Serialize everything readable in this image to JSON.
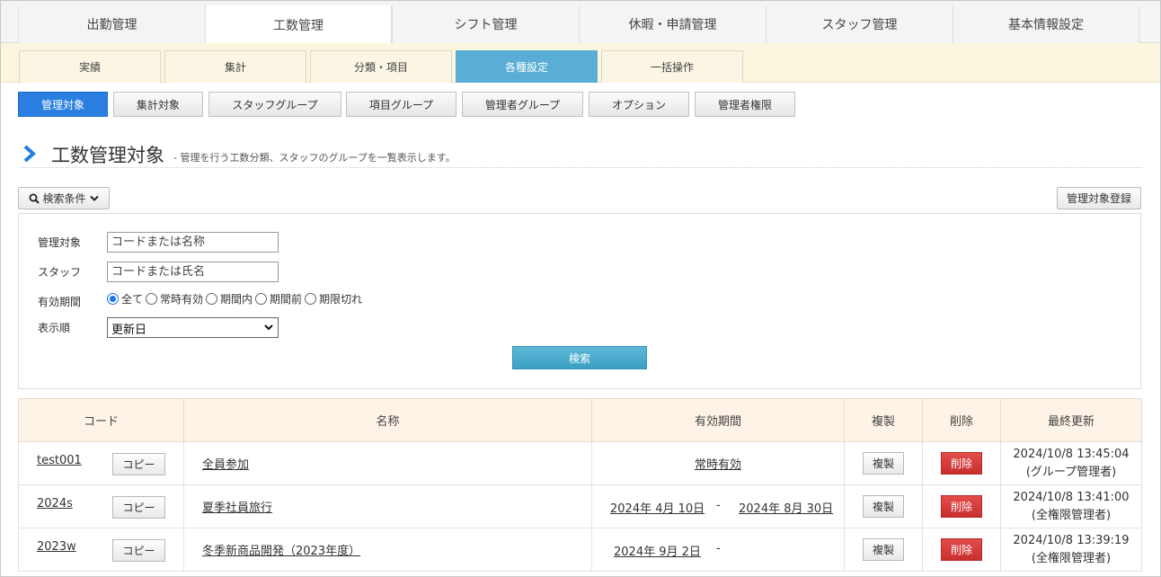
{
  "top_tabs": [
    "出勤管理",
    "工数管理",
    "シフト管理",
    "休暇・申請管理",
    "スタッフ管理",
    "基本情報設定"
  ],
  "top_active": "工数管理",
  "sub_tabs": [
    "実績",
    "集計",
    "分類・項目",
    "各種設定",
    "一括操作"
  ],
  "sub_active": "各種設定",
  "setting_buttons": [
    "管理対象",
    "集計対象",
    "スタッフグループ",
    "項目グループ",
    "管理者グループ",
    "オプション",
    "管理者権限"
  ],
  "setting_active": "管理対象",
  "page": {
    "title": "工数管理対象",
    "description": "- 管理を行う工数分類、スタッフのグループを一覧表示します。"
  },
  "search_toggle_label": "検索条件",
  "register_button": "管理対象登録",
  "search": {
    "target_label": "管理対象",
    "target_placeholder": "コードまたは名称",
    "staff_label": "スタッフ",
    "staff_placeholder": "コードまたは氏名",
    "period_label": "有効期間",
    "period_options": [
      "全て",
      "常時有効",
      "期間内",
      "期間前",
      "期限切れ"
    ],
    "period_selected": "全て",
    "order_label": "表示順",
    "order_value": "更新日",
    "submit_label": "検索"
  },
  "table": {
    "headers": [
      "コード",
      "名称",
      "有効期間",
      "複製",
      "削除",
      "最終更新"
    ],
    "copy_label": "コピー",
    "duplicate_label": "複製",
    "delete_label": "削除",
    "rows": [
      {
        "code": "test001",
        "name": "全員参加",
        "period_always": "常時有効",
        "period_start": "",
        "period_sep": "",
        "period_end": "",
        "updated": "2024/10/8 13:45:04",
        "updated_by": "(グループ管理者)"
      },
      {
        "code": "2024s",
        "name": "夏季社員旅行",
        "period_always": "",
        "period_start": "2024年 4月 10日",
        "period_sep": "-",
        "period_end": "2024年 8月 30日",
        "updated": "2024/10/8 13:41:00",
        "updated_by": "(全権限管理者)"
      },
      {
        "code": "2023w",
        "name": "冬季新商品開発（2023年度）",
        "period_always": "",
        "period_start": "2024年 9月 2日",
        "period_sep": "-",
        "period_end": "",
        "updated": "2024/10/8 13:39:19",
        "updated_by": "(全権限管理者)"
      }
    ]
  },
  "colors": {
    "accent_blue": "#2a7fe0",
    "subnav_active": "#5aaed6",
    "delete_red": "#d43c3c",
    "header_bg": "#fdf3e6"
  }
}
